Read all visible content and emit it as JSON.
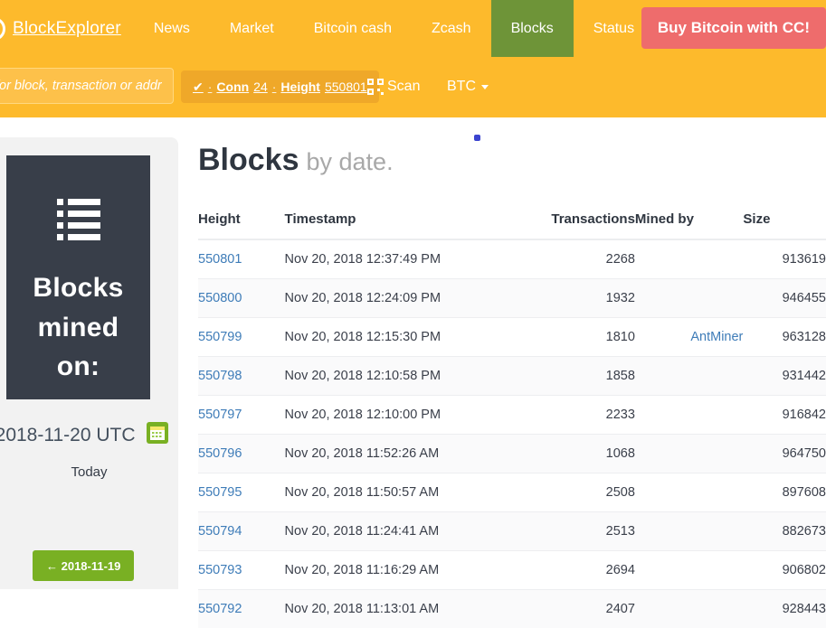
{
  "navbar": {
    "brand": "BlockExplorer",
    "brand_logo_icon": "circle-logo-icon",
    "links": [
      {
        "label": "News",
        "active": false
      },
      {
        "label": "Market",
        "active": false
      },
      {
        "label": "Bitcoin cash",
        "active": false
      },
      {
        "label": "Zcash",
        "active": false
      },
      {
        "label": "Blocks",
        "active": true
      },
      {
        "label": "Status",
        "active": false
      }
    ],
    "buy_button": "Buy Bitcoin with CC!",
    "search": {
      "value": "",
      "placeholder": "Search for block, transaction or address"
    },
    "status": {
      "check_icon": "check-icon",
      "conn_label": "Conn",
      "conn_value": "24",
      "height_label": "Height",
      "height_value": "550801",
      "separator": "·"
    },
    "scan": {
      "label": "Scan",
      "icon": "qr-code-icon"
    },
    "currency": {
      "label": "BTC",
      "icon": "chevron-down-icon"
    },
    "colors": {
      "navbar_bg": "#FDBA2C",
      "active_tab_bg": "#6E9438",
      "buy_button_bg": "#EE6C6C",
      "badge_bg": "#EFA829"
    }
  },
  "sidebar": {
    "card": {
      "icon": "list-icon",
      "title": "Blocks mined on:",
      "bg": "#383E49"
    },
    "date": "2018-11-20 UTC",
    "calendar_icon": "calendar-icon",
    "today_label": "Today",
    "prev_day_button": "← 2018-11-19",
    "accent_green": "#79B023"
  },
  "main": {
    "title": "Blocks",
    "subtitle": "by date.",
    "dot_color": "#3B44CF",
    "table": {
      "columns": [
        "Height",
        "Timestamp",
        "Transactions",
        "Mined by",
        "Size"
      ],
      "rows": [
        {
          "height": "550801",
          "timestamp": "Nov 20, 2018 12:37:49 PM",
          "transactions": "2268",
          "mined_by": "",
          "size": "913619"
        },
        {
          "height": "550800",
          "timestamp": "Nov 20, 2018 12:24:09 PM",
          "transactions": "1932",
          "mined_by": "",
          "size": "946455"
        },
        {
          "height": "550799",
          "timestamp": "Nov 20, 2018 12:15:30 PM",
          "transactions": "1810",
          "mined_by": "AntMiner",
          "size": "963128"
        },
        {
          "height": "550798",
          "timestamp": "Nov 20, 2018 12:10:58 PM",
          "transactions": "1858",
          "mined_by": "",
          "size": "931442"
        },
        {
          "height": "550797",
          "timestamp": "Nov 20, 2018 12:10:00 PM",
          "transactions": "2233",
          "mined_by": "",
          "size": "916842"
        },
        {
          "height": "550796",
          "timestamp": "Nov 20, 2018 11:52:26 AM",
          "transactions": "1068",
          "mined_by": "",
          "size": "964750"
        },
        {
          "height": "550795",
          "timestamp": "Nov 20, 2018 11:50:57 AM",
          "transactions": "2508",
          "mined_by": "",
          "size": "897608"
        },
        {
          "height": "550794",
          "timestamp": "Nov 20, 2018 11:24:41 AM",
          "transactions": "2513",
          "mined_by": "",
          "size": "882673"
        },
        {
          "height": "550793",
          "timestamp": "Nov 20, 2018 11:16:29 AM",
          "transactions": "2694",
          "mined_by": "",
          "size": "906802"
        },
        {
          "height": "550792",
          "timestamp": "Nov 20, 2018 11:13:01 AM",
          "transactions": "2407",
          "mined_by": "",
          "size": "928443"
        }
      ]
    }
  }
}
